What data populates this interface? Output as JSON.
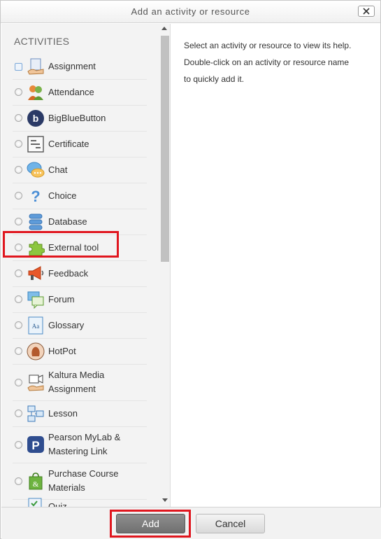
{
  "dialog": {
    "title": "Add an activity or resource",
    "close_label": "close"
  },
  "left": {
    "heading": "ACTIVITIES",
    "items": [
      {
        "label": "Assignment",
        "icon": "assignment-icon"
      },
      {
        "label": "Attendance",
        "icon": "attendance-icon"
      },
      {
        "label": "BigBlueButton",
        "icon": "bigbluebutton-icon"
      },
      {
        "label": "Certificate",
        "icon": "certificate-icon"
      },
      {
        "label": "Chat",
        "icon": "chat-icon"
      },
      {
        "label": "Choice",
        "icon": "choice-icon"
      },
      {
        "label": "Database",
        "icon": "database-icon"
      },
      {
        "label": "External tool",
        "icon": "external-tool-icon"
      },
      {
        "label": "Feedback",
        "icon": "feedback-icon"
      },
      {
        "label": "Forum",
        "icon": "forum-icon"
      },
      {
        "label": "Glossary",
        "icon": "glossary-icon"
      },
      {
        "label": "HotPot",
        "icon": "hotpot-icon"
      },
      {
        "label_line1": "Kaltura Media",
        "label_line2": "Assignment",
        "icon": "kaltura-icon"
      },
      {
        "label": "Lesson",
        "icon": "lesson-icon"
      },
      {
        "label_line1": "Pearson MyLab &",
        "label_line2": "Mastering Link",
        "icon": "pearson-icon"
      },
      {
        "label_line1": "Purchase Course",
        "label_line2": "Materials",
        "icon": "purchase-icon"
      },
      {
        "label": "Quiz",
        "icon": "quiz-icon"
      }
    ]
  },
  "help": {
    "line1": "Select an activity or resource to view its help.",
    "line2": "Double-click on an activity or resource name",
    "line3": "to quickly add it."
  },
  "footer": {
    "add_label": "Add",
    "cancel_label": "Cancel"
  },
  "colors": {
    "highlight": "#e0161e",
    "add_button": "#7a7a7a",
    "pane_background": "#f3f3f3"
  }
}
